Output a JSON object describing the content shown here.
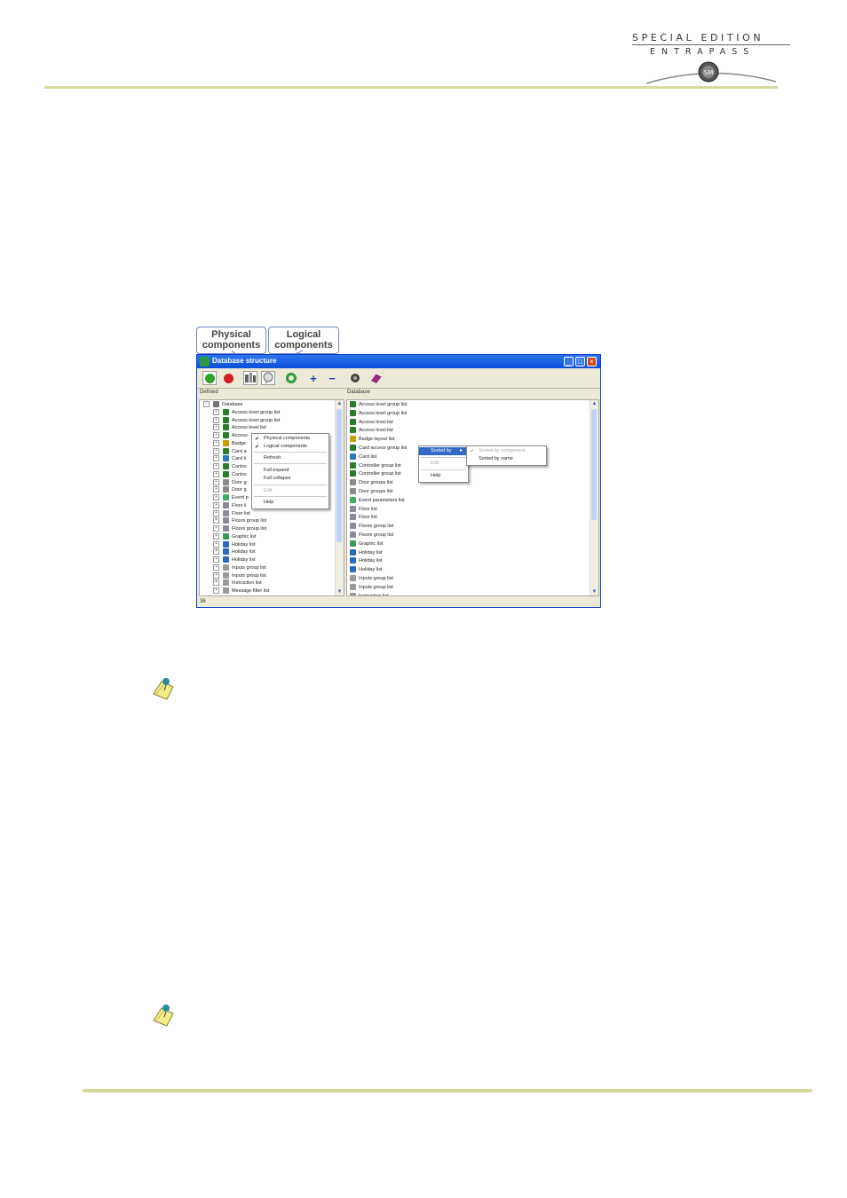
{
  "header": {
    "logo_line1": "SPECIAL EDITION",
    "logo_line2": "ENTRAPASS",
    "logo_mark": "SM"
  },
  "callouts": {
    "physical": "Physical components",
    "logical": "Logical components"
  },
  "window": {
    "title": "Database structure",
    "min": "_",
    "max": "□",
    "close": "×",
    "left_pane_label": "Defined",
    "right_pane_label": "Database",
    "status": "36",
    "toolbar": {
      "plus": "+",
      "minus": "−"
    },
    "left_tree": [
      {
        "label": "Database",
        "exp": "−",
        "color": "#777777"
      },
      {
        "label": "Access level group list",
        "exp": "+",
        "color": "#2d7a2d"
      },
      {
        "label": "Access level group list",
        "exp": "+",
        "color": "#2d7a2d"
      },
      {
        "label": "Access level list",
        "exp": "+",
        "color": "#2d7a2d"
      },
      {
        "label": "Access",
        "exp": "+",
        "color": "#2d7a2d"
      },
      {
        "label": "Badge",
        "exp": "+",
        "color": "#c6a000"
      },
      {
        "label": "Card a",
        "exp": "+",
        "color": "#2d7a2d"
      },
      {
        "label": "Card li",
        "exp": "+",
        "color": "#2a7ab8"
      },
      {
        "label": "Contro",
        "exp": "+",
        "color": "#2d7a2d"
      },
      {
        "label": "Contro",
        "exp": "+",
        "color": "#2d7a2d"
      },
      {
        "label": "Door g",
        "exp": "+",
        "color": "#8a8a8a"
      },
      {
        "label": "Door g",
        "exp": "+",
        "color": "#8a8a8a"
      },
      {
        "label": "Event p",
        "exp": "+",
        "color": "#44aa66"
      },
      {
        "label": "Floor li",
        "exp": "+",
        "color": "#8a8a9a"
      },
      {
        "label": "Floor list",
        "exp": "+",
        "color": "#8a8a9a"
      },
      {
        "label": "Floors group list",
        "exp": "+",
        "color": "#8a8a9a"
      },
      {
        "label": "Floors group list",
        "exp": "+",
        "color": "#8a8a9a"
      },
      {
        "label": "Graphic list",
        "exp": "+",
        "color": "#3a9a5a"
      },
      {
        "label": "Holiday list",
        "exp": "+",
        "color": "#2a6ab8"
      },
      {
        "label": "Holiday list",
        "exp": "+",
        "color": "#2a6ab8"
      },
      {
        "label": "Holiday list",
        "exp": "+",
        "color": "#2a6ab8"
      },
      {
        "label": "Inputs group list",
        "exp": "+",
        "color": "#9a9a9a"
      },
      {
        "label": "Inputs group list",
        "exp": "+",
        "color": "#9a9a9a"
      },
      {
        "label": "Instruction list",
        "exp": "+",
        "color": "#9a9a9a"
      },
      {
        "label": "Message filter list",
        "exp": "+",
        "color": "#9a9a9a"
      }
    ],
    "right_list": [
      {
        "label": "Access level group list",
        "color": "#2d7a2d"
      },
      {
        "label": "Access level group list",
        "color": "#2d7a2d"
      },
      {
        "label": "Access level list",
        "color": "#2d7a2d"
      },
      {
        "label": "Access level list",
        "color": "#2d7a2d"
      },
      {
        "label": "Badge layout list",
        "color": "#c6a000"
      },
      {
        "label": "Card access group list",
        "color": "#2d7a2d"
      },
      {
        "label": "Card list",
        "color": "#2a7ab8"
      },
      {
        "label": "Controller group list",
        "color": "#2d7a2d"
      },
      {
        "label": "Controller group list",
        "color": "#2d7a2d"
      },
      {
        "label": "Door groups list",
        "color": "#8a8a8a"
      },
      {
        "label": "Door groups list",
        "color": "#8a8a8a"
      },
      {
        "label": "Event parameters list",
        "color": "#44aa66"
      },
      {
        "label": "Floor list",
        "color": "#8a8a9a"
      },
      {
        "label": "Floor list",
        "color": "#8a8a9a"
      },
      {
        "label": "Floors group list",
        "color": "#8a8a9a"
      },
      {
        "label": "Floors group list",
        "color": "#8a8a9a"
      },
      {
        "label": "Graphic list",
        "color": "#3a9a5a"
      },
      {
        "label": "Holiday list",
        "color": "#2a6ab8"
      },
      {
        "label": "Holiday list",
        "color": "#2a6ab8"
      },
      {
        "label": "Holiday list",
        "color": "#2a6ab8"
      },
      {
        "label": "Inputs group list",
        "color": "#9a9a9a"
      },
      {
        "label": "Inputs group list",
        "color": "#9a9a9a"
      },
      {
        "label": "Instruction list",
        "color": "#9a9a9a"
      }
    ],
    "left_menu": {
      "physical": "Physical components",
      "logical": "Logical components",
      "refresh": "Refresh",
      "full_expand": "Full expand",
      "full_collapse": "Full collapse",
      "edit": "Edit",
      "help": "Help",
      "check": "✔"
    },
    "right_menu": {
      "sorted_by": "Sorted by",
      "edit": "Edit",
      "help": "Help",
      "arrow": "▸"
    },
    "sub_menu": {
      "by_component": "Sorted by component",
      "by_name": "Sorted by name",
      "check": "✔"
    }
  }
}
